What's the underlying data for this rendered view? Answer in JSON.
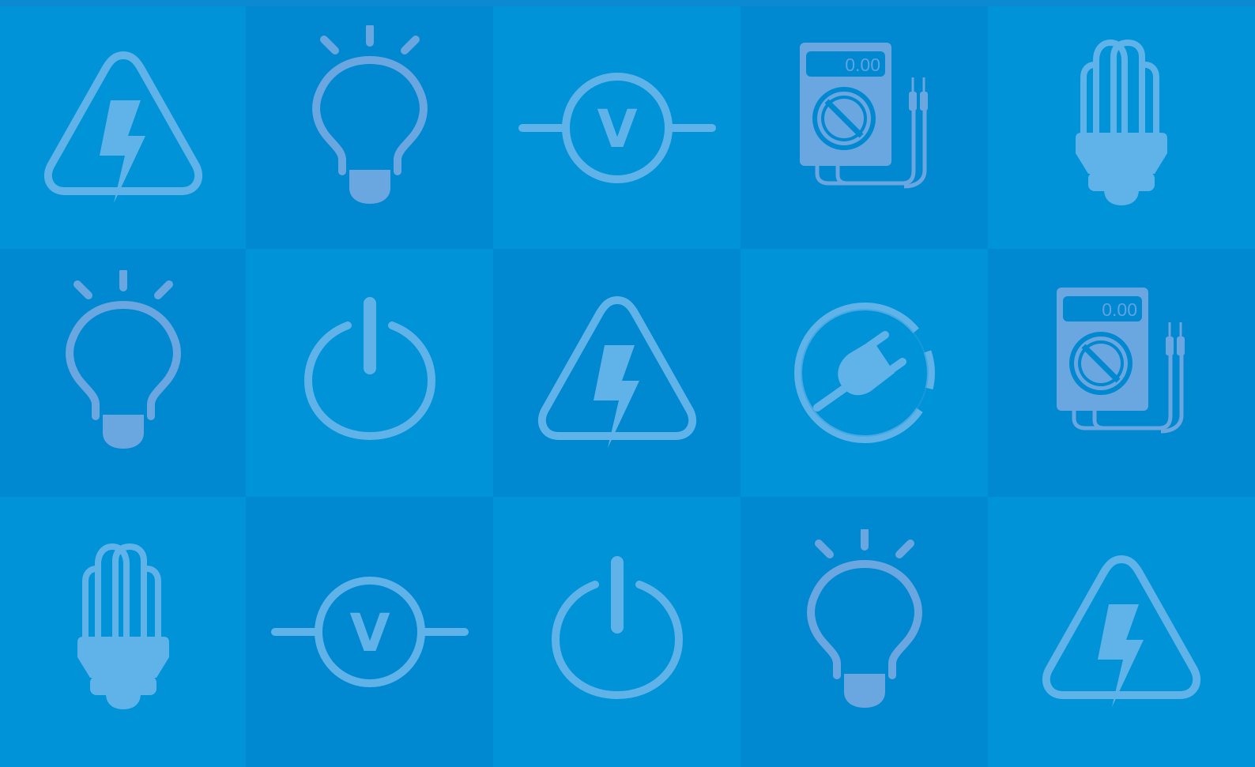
{
  "background": {
    "base": "#0b8ad2",
    "tile_light": "#0093d8",
    "tile_dark": "#0088d1",
    "icon_color": "#5fb3e8",
    "icon_color_alt": "#6aa6df"
  },
  "tiles": [
    {
      "row": 1,
      "col": 1,
      "icon": "high-voltage-warning-icon",
      "shade": "light"
    },
    {
      "row": 1,
      "col": 2,
      "icon": "light-bulb-icon",
      "shade": "dark"
    },
    {
      "row": 1,
      "col": 3,
      "icon": "voltmeter-symbol-icon",
      "shade": "light"
    },
    {
      "row": 1,
      "col": 4,
      "icon": "multimeter-icon",
      "shade": "dark",
      "readout": "0.00"
    },
    {
      "row": 1,
      "col": 5,
      "icon": "cfl-bulb-icon",
      "shade": "light"
    },
    {
      "row": 2,
      "col": 1,
      "icon": "light-bulb-icon",
      "shade": "dark"
    },
    {
      "row": 2,
      "col": 2,
      "icon": "power-button-icon",
      "shade": "light"
    },
    {
      "row": 2,
      "col": 3,
      "icon": "high-voltage-warning-icon",
      "shade": "dark"
    },
    {
      "row": 2,
      "col": 4,
      "icon": "unplug-icon",
      "shade": "light"
    },
    {
      "row": 2,
      "col": 5,
      "icon": "multimeter-icon",
      "shade": "dark",
      "readout": "0.00"
    },
    {
      "row": 3,
      "col": 1,
      "icon": "cfl-bulb-icon",
      "shade": "light"
    },
    {
      "row": 3,
      "col": 2,
      "icon": "voltmeter-symbol-icon",
      "shade": "dark"
    },
    {
      "row": 3,
      "col": 3,
      "icon": "power-button-icon",
      "shade": "light"
    },
    {
      "row": 3,
      "col": 4,
      "icon": "light-bulb-icon",
      "shade": "dark"
    },
    {
      "row": 3,
      "col": 5,
      "icon": "high-voltage-warning-icon",
      "shade": "light"
    }
  ],
  "multimeter": {
    "readout": "0.00"
  },
  "voltmeter": {
    "symbol": "V"
  }
}
